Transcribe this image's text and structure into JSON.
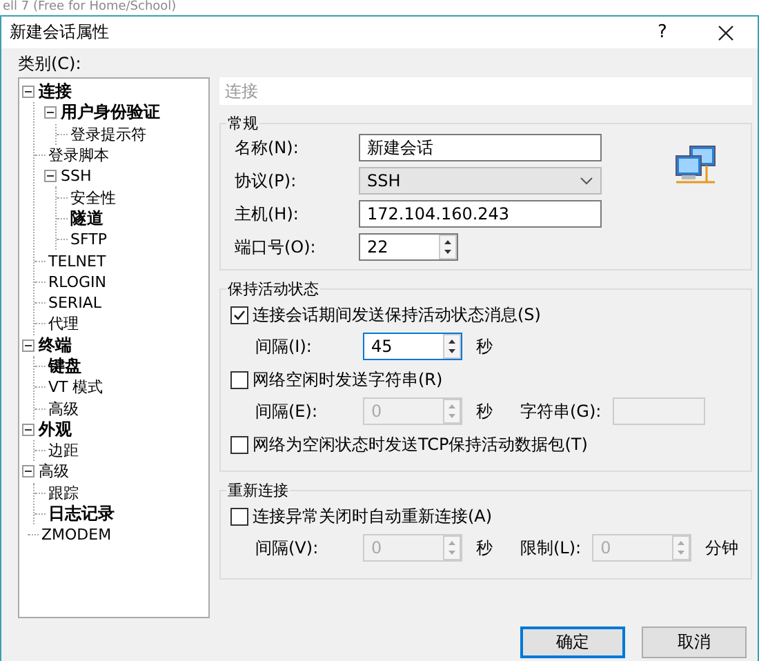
{
  "background_window": {
    "title": "ell 7 (Free for Home/School)"
  },
  "window": {
    "title": "新建会话属性",
    "help": "?"
  },
  "category_label": "类别(C):",
  "tree": [
    {
      "label": "连接",
      "bold": true,
      "expanded": true,
      "children": [
        {
          "label": "用户身份验证",
          "bold": true,
          "expanded": true,
          "children": [
            {
              "label": "登录提示符",
              "bold": false
            }
          ]
        },
        {
          "label": "登录脚本",
          "bold": false
        },
        {
          "label": "SSH",
          "bold": false,
          "expanded": true,
          "children": [
            {
              "label": "安全性",
              "bold": false
            },
            {
              "label": "隧道",
              "bold": true
            },
            {
              "label": "SFTP",
              "bold": false
            }
          ]
        },
        {
          "label": "TELNET",
          "bold": false
        },
        {
          "label": "RLOGIN",
          "bold": false
        },
        {
          "label": "SERIAL",
          "bold": false
        },
        {
          "label": "代理",
          "bold": false
        }
      ]
    },
    {
      "label": "终端",
      "bold": true,
      "expanded": true,
      "children": [
        {
          "label": "键盘",
          "bold": true
        },
        {
          "label": "VT 模式",
          "bold": false
        },
        {
          "label": "高级",
          "bold": false
        }
      ]
    },
    {
      "label": "外观",
      "bold": true,
      "expanded": true,
      "children": [
        {
          "label": "边距",
          "bold": false
        }
      ]
    },
    {
      "label": "高级",
      "bold": false,
      "expanded": true,
      "children": [
        {
          "label": "跟踪",
          "bold": false
        },
        {
          "label": "日志记录",
          "bold": true
        }
      ]
    },
    {
      "label": "ZMODEM",
      "bold": false
    }
  ],
  "panel_title": "连接",
  "general": {
    "title": "常规",
    "fields": [
      {
        "kind": "text",
        "label": "名称(N):",
        "value": "新建会话"
      },
      {
        "kind": "dropdown",
        "label": "协议(P):",
        "value": "SSH"
      },
      {
        "kind": "text",
        "label": "主机(H):",
        "value": "172.104.160.243"
      },
      {
        "kind": "spinner",
        "label": "端口号(O):",
        "value": "22"
      }
    ]
  },
  "groups": [
    {
      "title": "保持活动状态",
      "items": [
        {
          "kind": "checkbox",
          "label": "连接会话期间发送保持活动状态消息(S)",
          "checked": true
        },
        {
          "kind": "fields",
          "fields": [
            {
              "kind": "spinner",
              "label": "间隔(I):",
              "value": "45",
              "unit": "秒",
              "disabled": false,
              "focused": true
            }
          ]
        },
        {
          "kind": "checkbox",
          "label": "网络空闲时发送字符串(R)",
          "checked": false
        },
        {
          "kind": "fields",
          "fields": [
            {
              "kind": "spinner",
              "label": "间隔(E):",
              "value": "0",
              "unit": "秒",
              "disabled": true,
              "focused": false
            },
            {
              "kind": "text",
              "label": "字符串(G):",
              "disabled": true
            }
          ]
        },
        {
          "kind": "checkbox",
          "label": "网络为空闲状态时发送TCP保持活动数据包(T)",
          "checked": false
        }
      ]
    },
    {
      "title": "重新连接",
      "items": [
        {
          "kind": "checkbox",
          "label": "连接异常关闭时自动重新连接(A)",
          "checked": false
        },
        {
          "kind": "fields",
          "fields": [
            {
              "kind": "spinner",
              "label": "间隔(V):",
              "value": "0",
              "unit": "秒",
              "disabled": true,
              "focused": false
            },
            {
              "kind": "spinner",
              "label": "限制(L):",
              "value": "0",
              "unit": "分钟",
              "disabled": true,
              "focused": false
            }
          ]
        }
      ]
    }
  ],
  "buttons": [
    {
      "label": "确定",
      "default": true
    },
    {
      "label": "取消",
      "default": false
    }
  ]
}
